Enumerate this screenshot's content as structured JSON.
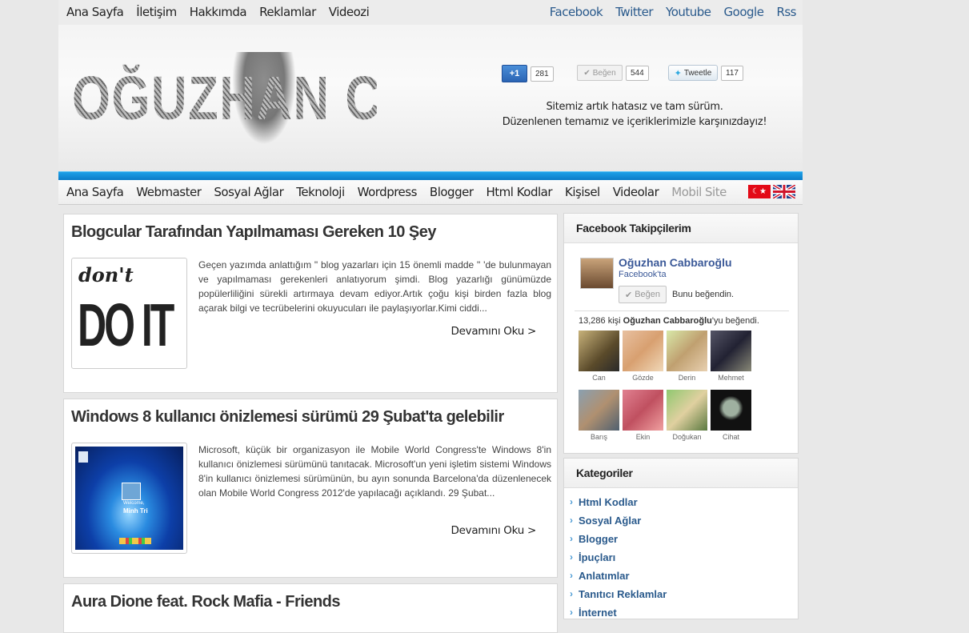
{
  "top_nav": [
    "Ana Sayfa",
    "İletişim",
    "Hakkımda",
    "Reklamlar",
    "Videozi"
  ],
  "social_links": [
    "Facebook",
    "Twitter",
    "Youtube",
    "Google",
    "Rss"
  ],
  "logo": {
    "text": "OĞUZHAN CABBAROĞLU"
  },
  "share": {
    "gplus": {
      "label": "+1",
      "count": "281"
    },
    "facebook": {
      "label": "Beğen",
      "count": "544"
    },
    "twitter": {
      "label": "Tweetle",
      "count": "117"
    }
  },
  "tagline": [
    "Sitemiz artık hatasız ve tam sürüm.",
    "Düzenlenen temamız ve içeriklerimizle karşınızdayız!"
  ],
  "main_nav": [
    "Ana Sayfa",
    "Webmaster",
    "Sosyal Ağlar",
    "Teknoloji",
    "Wordpress",
    "Blogger",
    "Html Kodlar",
    "Kişisel",
    "Videolar",
    "Mobil Site"
  ],
  "posts": [
    {
      "title": "Blogcular Tarafından Yapılmaması Gereken 10 Şey",
      "thumb_top": "don't",
      "thumb_main": "DO IT",
      "excerpt": "Geçen yazımda anlattığım \" blog yazarları için 15 önemli madde \" 'de bulunmayan ve yapılmaması gerekenleri anlatıyorum şimdi. Blog yazarlığı günümüzde popülerliliğini sürekli artırmaya devam ediyor.Artık çoğu kişi birden fazla blog açarak bilgi ve tecrübelerini okuyucuları ile paylaşıyorlar.Kimi ciddi...",
      "read_more": "Devamını Oku >"
    },
    {
      "title": "Windows 8 kullanıcı önizlemesi sürümü 29 Şubat'ta gelebilir",
      "thumb_welcome": "Welcome,",
      "thumb_user": "Minh Tri",
      "excerpt": "Microsoft, küçük bir organizasyon ile Mobile World Congress'te Windows 8'in kullanıcı önizlemesi sürümünü tanıtacak. Microsoft'un yeni işletim sistemi Windows 8'in kullanıcı önizlemesi sürümünün, bu ayın sonunda Barcelona'da düzenlenecek olan Mobile World Congress 2012'de yapılacağı açıklandı. 29 Şubat...",
      "read_more": "Devamını Oku >"
    },
    {
      "title": "Aura Dione feat. Rock Mafia - Friends"
    }
  ],
  "facebook_widget": {
    "title": "Facebook Takipçilerim",
    "page_name": "Oğuzhan Cabbaroğlu",
    "page_sub": "Facebook'ta",
    "like_label": "Beğen",
    "liked_text": "Bunu beğendin.",
    "count_prefix": "13,286 kişi ",
    "count_name": "Oğuzhan Cabbaroğlu",
    "count_suffix": "'yu beğendi.",
    "fans": [
      "Can",
      "Gözde",
      "Derin",
      "Mehmet",
      "Barış",
      "Ekin",
      "Doğukan",
      "Cihat"
    ]
  },
  "categories_widget": {
    "title": "Kategoriler",
    "items": [
      "Html Kodlar",
      "Sosyal Ağlar",
      "Blogger",
      "İpuçları",
      "Anlatımlar",
      "Tanıtıcı Reklamlar",
      "İnternet"
    ]
  },
  "colors": {
    "accent_blue": "#0b7cc7",
    "link": "#2a5a8c",
    "facebook": "#3b5998"
  }
}
